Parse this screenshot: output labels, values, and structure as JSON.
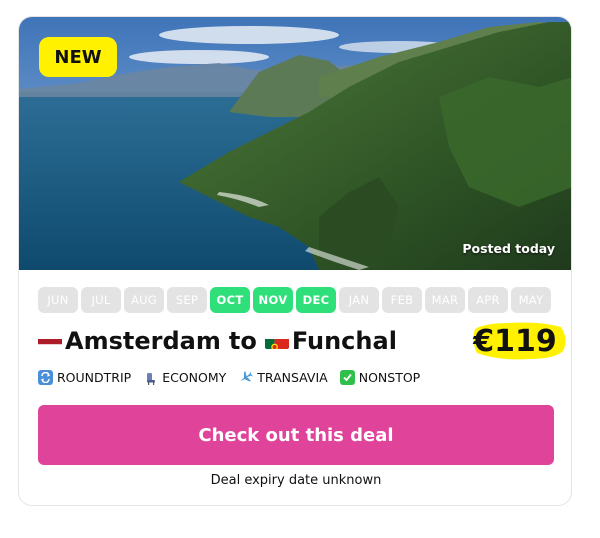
{
  "badge": {
    "label": "NEW"
  },
  "hero": {
    "posted": "Posted today",
    "image": "madeira-coastline-photo"
  },
  "months": [
    {
      "label": "JUN",
      "active": false
    },
    {
      "label": "JUL",
      "active": false
    },
    {
      "label": "AUG",
      "active": false
    },
    {
      "label": "SEP",
      "active": false
    },
    {
      "label": "OCT",
      "active": true
    },
    {
      "label": "NOV",
      "active": true
    },
    {
      "label": "DEC",
      "active": true
    },
    {
      "label": "JAN",
      "active": false
    },
    {
      "label": "FEB",
      "active": false
    },
    {
      "label": "MAR",
      "active": false
    },
    {
      "label": "APR",
      "active": false
    },
    {
      "label": "MAY",
      "active": false
    }
  ],
  "route": {
    "origin": "Amsterdam",
    "connector": "to",
    "destination": "Funchal",
    "origin_flag": "netherlands-flag-icon",
    "destination_flag": "portugal-flag-icon"
  },
  "price": {
    "value": "€119",
    "highlight_color": "#fff100"
  },
  "tags": [
    {
      "label": "ROUNDTRIP",
      "icon": "roundtrip-icon"
    },
    {
      "label": "ECONOMY",
      "icon": "seat-icon"
    },
    {
      "label": "TRANSAVIA",
      "icon": "airplane-icon"
    },
    {
      "label": "NONSTOP",
      "icon": "check-icon"
    }
  ],
  "cta": {
    "label": "Check out this deal",
    "color": "#e0449a"
  },
  "expiry": "Deal expiry date unknown",
  "colors": {
    "active_month": "#2fe07a",
    "inactive_month": "#e3e3e3"
  }
}
